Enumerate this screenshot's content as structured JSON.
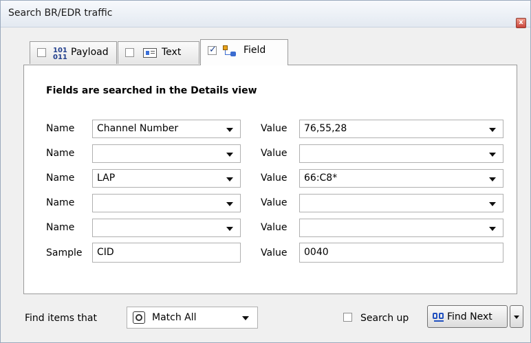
{
  "window": {
    "title": "Search BR/EDR traffic",
    "close_glyph": "x"
  },
  "tabs": [
    {
      "label": "Payload",
      "checked": false,
      "icon": "binary-icon",
      "icon_text": "101\n011"
    },
    {
      "label": "Text",
      "checked": false,
      "icon": "text-document-icon"
    },
    {
      "label": "Field",
      "checked": true,
      "icon": "field-tree-icon",
      "active": true
    }
  ],
  "panel": {
    "heading": "Fields are searched in the Details view",
    "rows": [
      {
        "left_label": "Name",
        "left_value": "Channel Number",
        "right_label": "Value",
        "right_value": "76,55,28"
      },
      {
        "left_label": "Name",
        "left_value": "",
        "right_label": "Value",
        "right_value": ""
      },
      {
        "left_label": "Name",
        "left_value": "LAP",
        "right_label": "Value",
        "right_value": "66:C8*"
      },
      {
        "left_label": "Name",
        "left_value": "",
        "right_label": "Value",
        "right_value": ""
      },
      {
        "left_label": "Name",
        "left_value": "",
        "right_label": "Value",
        "right_value": ""
      },
      {
        "left_label": "Sample",
        "left_value": "CID",
        "right_label": "Value",
        "right_value": "0040"
      }
    ]
  },
  "footer": {
    "find_items_label": "Find items that",
    "match_value": "Match All",
    "search_up_label": "Search up",
    "search_up_checked": false,
    "find_next_label": "Find Next"
  }
}
